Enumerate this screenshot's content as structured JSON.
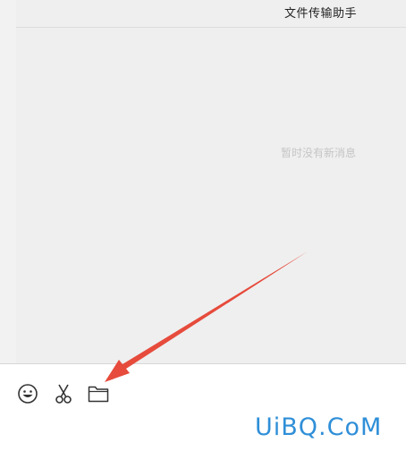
{
  "chat": {
    "title": "文件传输助手",
    "empty_message": "暂时没有新消息"
  },
  "toolbar": {
    "icons": [
      "emoji-icon",
      "scissors-icon",
      "folder-icon"
    ]
  },
  "annotation": {
    "arrow_color": "#e64b3c"
  },
  "watermark": {
    "text": "UiBQ.CoM",
    "color": "#2f8fd8"
  }
}
